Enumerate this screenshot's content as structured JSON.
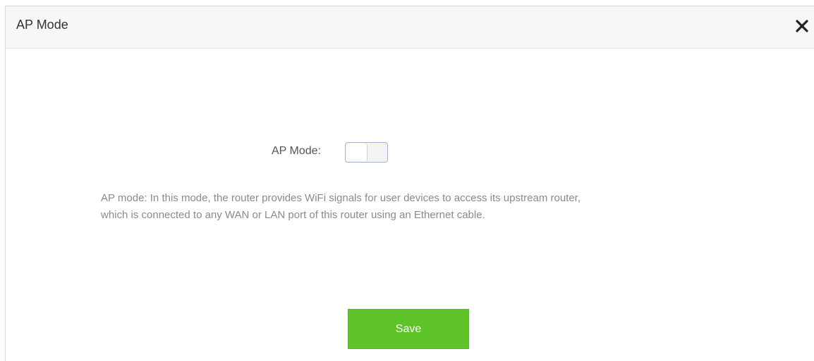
{
  "dialog": {
    "title": "AP Mode",
    "close_icon": "close-icon"
  },
  "form": {
    "ap_mode_label": "AP Mode:",
    "ap_mode_enabled": false,
    "description_line1": "AP mode: In this mode, the router provides WiFi signals for user devices to access its upstream router,",
    "description_line2": "which is connected to any WAN or LAN port of this router using an Ethernet cable."
  },
  "actions": {
    "save_label": "Save"
  },
  "colors": {
    "save_button": "#5ec42a",
    "header_background": "#f7f7f7",
    "description_text": "#8a8a8a"
  }
}
